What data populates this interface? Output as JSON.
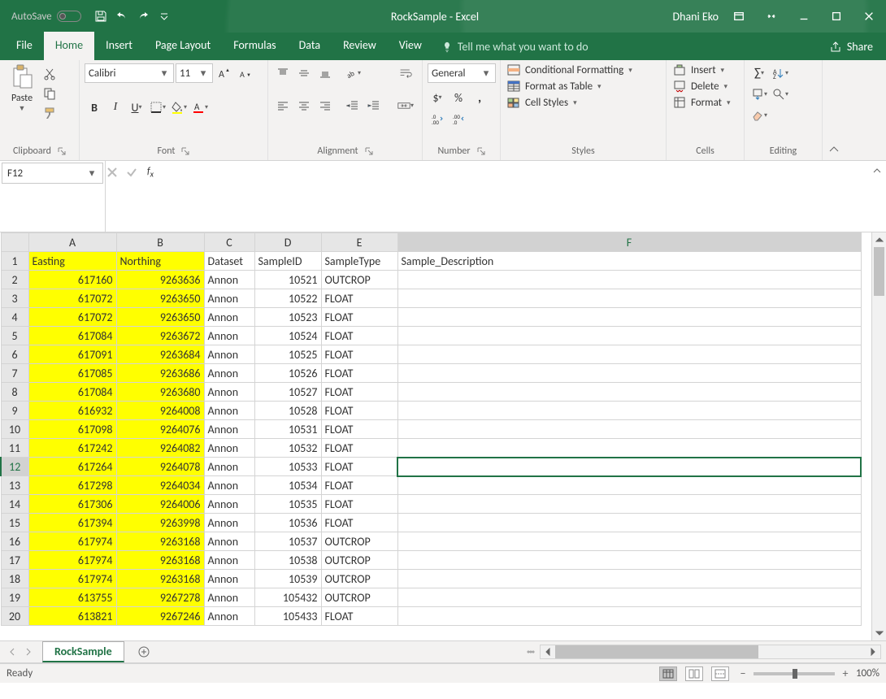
{
  "titlebar": {
    "autosave_label": "AutoSave",
    "autosave_state": "Off",
    "title": "RockSample - Excel",
    "user": "Dhani Eko"
  },
  "tabs": [
    "File",
    "Home",
    "Insert",
    "Page Layout",
    "Formulas",
    "Data",
    "Review",
    "View"
  ],
  "active_tab": "Home",
  "tellme_placeholder": "Tell me what you want to do",
  "share_label": "Share",
  "ribbon": {
    "clipboard": {
      "label": "Clipboard",
      "paste": "Paste"
    },
    "font": {
      "label": "Font",
      "name": "Calibri",
      "size": "11"
    },
    "alignment": {
      "label": "Alignment"
    },
    "number": {
      "label": "Number",
      "format": "General"
    },
    "styles": {
      "label": "Styles",
      "cond": "Conditional Formatting",
      "table": "Format as Table",
      "cell": "Cell Styles"
    },
    "cells": {
      "label": "Cells",
      "insert": "Insert",
      "delete": "Delete",
      "format": "Format"
    },
    "editing": {
      "label": "Editing"
    }
  },
  "namebox": "F12",
  "columns": [
    "A",
    "B",
    "C",
    "D",
    "E",
    "F"
  ],
  "headers": [
    "Easting",
    "Northing",
    "Dataset",
    "SampleID",
    "SampleType",
    "Sample_Description"
  ],
  "rows": [
    {
      "r": 2,
      "easting": 617160,
      "northing": 9263636,
      "dataset": "Annon",
      "id": 10521,
      "type": "OUTCROP"
    },
    {
      "r": 3,
      "easting": 617072,
      "northing": 9263650,
      "dataset": "Annon",
      "id": 10522,
      "type": "FLOAT"
    },
    {
      "r": 4,
      "easting": 617072,
      "northing": 9263650,
      "dataset": "Annon",
      "id": 10523,
      "type": "FLOAT"
    },
    {
      "r": 5,
      "easting": 617084,
      "northing": 9263672,
      "dataset": "Annon",
      "id": 10524,
      "type": "FLOAT"
    },
    {
      "r": 6,
      "easting": 617091,
      "northing": 9263684,
      "dataset": "Annon",
      "id": 10525,
      "type": "FLOAT"
    },
    {
      "r": 7,
      "easting": 617085,
      "northing": 9263686,
      "dataset": "Annon",
      "id": 10526,
      "type": "FLOAT"
    },
    {
      "r": 8,
      "easting": 617084,
      "northing": 9263680,
      "dataset": "Annon",
      "id": 10527,
      "type": "FLOAT"
    },
    {
      "r": 9,
      "easting": 616932,
      "northing": 9264008,
      "dataset": "Annon",
      "id": 10528,
      "type": "FLOAT"
    },
    {
      "r": 10,
      "easting": 617098,
      "northing": 9264076,
      "dataset": "Annon",
      "id": 10531,
      "type": "FLOAT"
    },
    {
      "r": 11,
      "easting": 617242,
      "northing": 9264082,
      "dataset": "Annon",
      "id": 10532,
      "type": "FLOAT"
    },
    {
      "r": 12,
      "easting": 617264,
      "northing": 9264078,
      "dataset": "Annon",
      "id": 10533,
      "type": "FLOAT"
    },
    {
      "r": 13,
      "easting": 617298,
      "northing": 9264034,
      "dataset": "Annon",
      "id": 10534,
      "type": "FLOAT"
    },
    {
      "r": 14,
      "easting": 617306,
      "northing": 9264006,
      "dataset": "Annon",
      "id": 10535,
      "type": "FLOAT"
    },
    {
      "r": 15,
      "easting": 617394,
      "northing": 9263998,
      "dataset": "Annon",
      "id": 10536,
      "type": "FLOAT"
    },
    {
      "r": 16,
      "easting": 617974,
      "northing": 9263168,
      "dataset": "Annon",
      "id": 10537,
      "type": "OUTCROP"
    },
    {
      "r": 17,
      "easting": 617974,
      "northing": 9263168,
      "dataset": "Annon",
      "id": 10538,
      "type": "OUTCROP"
    },
    {
      "r": 18,
      "easting": 617974,
      "northing": 9263168,
      "dataset": "Annon",
      "id": 10539,
      "type": "OUTCROP"
    },
    {
      "r": 19,
      "easting": 613755,
      "northing": 9267278,
      "dataset": "Annon",
      "id": 105432,
      "type": "OUTCROP"
    },
    {
      "r": 20,
      "easting": 613821,
      "northing": 9267246,
      "dataset": "Annon",
      "id": 105433,
      "type": "FLOAT"
    }
  ],
  "selected_row": 12,
  "selected_col": "F",
  "sheet_tab": "RockSample",
  "status": {
    "ready": "Ready",
    "zoom": "100%"
  }
}
